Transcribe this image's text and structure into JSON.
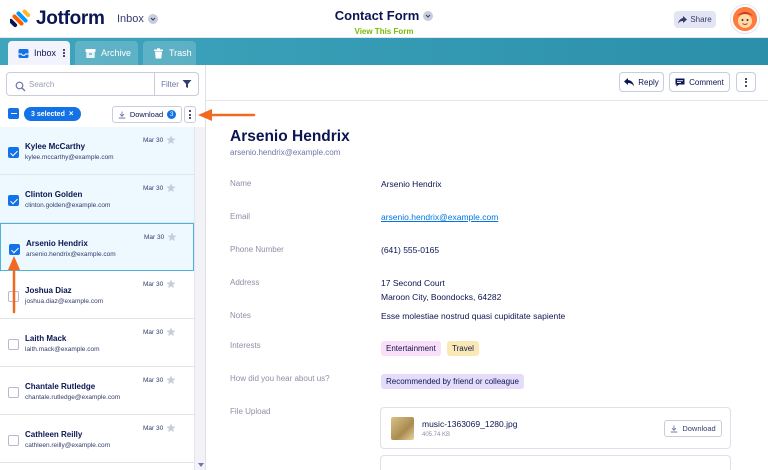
{
  "app": {
    "logo_text": "Jotform",
    "switcher_label": "Inbox"
  },
  "form": {
    "title": "Contact Form",
    "view_link": "View This Form"
  },
  "header": {
    "share_label": "Share"
  },
  "tabs": [
    {
      "label": "Inbox"
    },
    {
      "label": "Archive"
    },
    {
      "label": "Trash"
    }
  ],
  "search": {
    "placeholder": "Search",
    "filter_label": "Filter"
  },
  "bulk": {
    "selected_label": "3 selected",
    "download_label": "Download",
    "download_count": "3"
  },
  "submissions": [
    {
      "name": "Kylee McCarthy",
      "email": "kylee.mccarthy@example.com",
      "date": "Mar 30",
      "checked": true,
      "current": false
    },
    {
      "name": "Clinton Golden",
      "email": "clinton.golden@example.com",
      "date": "Mar 30",
      "checked": true,
      "current": false
    },
    {
      "name": "Arsenio Hendrix",
      "email": "arsenio.hendrix@example.com",
      "date": "Mar 30",
      "checked": true,
      "current": true
    },
    {
      "name": "Joshua Diaz",
      "email": "joshua.diaz@example.com",
      "date": "Mar 30",
      "checked": false,
      "current": false
    },
    {
      "name": "Laith Mack",
      "email": "laith.mack@example.com",
      "date": "Mar 30",
      "checked": false,
      "current": false
    },
    {
      "name": "Chantale Rutledge",
      "email": "chantale.rutledge@example.com",
      "date": "Mar 30",
      "checked": false,
      "current": false
    },
    {
      "name": "Cathleen Reilly",
      "email": "cathleen.reilly@example.com",
      "date": "Mar 30",
      "checked": false,
      "current": false
    }
  ],
  "toolbar": {
    "reply_label": "Reply",
    "comment_label": "Comment"
  },
  "detail": {
    "name": "Arsenio Hendrix",
    "email": "arsenio.hendrix@example.com",
    "fields": {
      "name_label": "Name",
      "name_value": "Arsenio Hendrix",
      "email_label": "Email",
      "email_value": "arsenio.hendrix@example.com",
      "phone_label": "Phone Number",
      "phone_value": "(641) 555-0165",
      "address_label": "Address",
      "address_line1": "17 Second Court",
      "address_line2": "Maroon City, Boondocks, 64282",
      "notes_label": "Notes",
      "notes_value": "Esse molestiae nostrud quasi cupiditate sapiente",
      "interests_label": "Interests",
      "interests": [
        "Entertainment",
        "Travel"
      ],
      "heard_label": "How did you hear about us?",
      "heard_value": "Recommended by friend or colleague",
      "upload_label": "File Upload"
    },
    "file": {
      "name": "music-1363069_1280.jpg",
      "size": "405.74 KB",
      "download_label": "Download"
    }
  },
  "colors": {
    "accent": "#1373e6",
    "tab_bar": "#3fa5bd",
    "arrow": "#f26a21",
    "link": "#0075e3",
    "view_link": "#78bb07"
  }
}
